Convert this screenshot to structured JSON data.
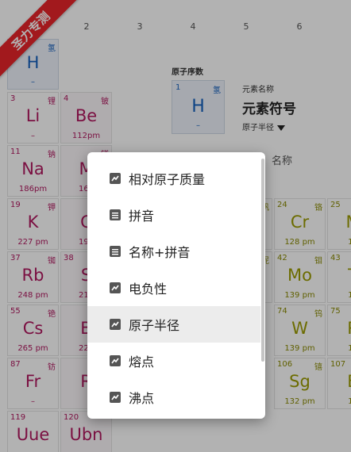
{
  "column_numbers": [
    "2",
    "3",
    "4",
    "5",
    "6"
  ],
  "legend": {
    "title": "原子序数",
    "cell": {
      "number": "1",
      "name": "氢",
      "symbol": "H",
      "radius": "–"
    },
    "name_label": "元素名称",
    "symbol_label": "元素符号",
    "property_label": "原子半径",
    "name_label_2": "名称"
  },
  "cells": [
    {
      "number": "",
      "name": "氢",
      "symbol": "H",
      "radius": "–",
      "color": "blue"
    },
    {
      "number": "3",
      "name": "锂",
      "symbol": "Li",
      "radius": "–",
      "color": "magenta"
    },
    {
      "number": "4",
      "name": "铍",
      "symbol": "Be",
      "radius": "112pm",
      "color": "magenta"
    },
    {
      "number": "11",
      "name": "钠",
      "symbol": "Na",
      "radius": "186pm",
      "color": "magenta"
    },
    {
      "number": "",
      "name": "镁",
      "symbol": "M",
      "radius": "160",
      "color": "magenta"
    },
    {
      "number": "19",
      "name": "钾",
      "symbol": "K",
      "radius": "227 pm",
      "color": "magenta"
    },
    {
      "number": "",
      "name": "",
      "symbol": "C",
      "radius": "197",
      "color": "magenta"
    },
    {
      "number": "37",
      "name": "铷",
      "symbol": "Rb",
      "radius": "248 pm",
      "color": "magenta"
    },
    {
      "number": "38",
      "name": "",
      "symbol": "S",
      "radius": "215",
      "color": "magenta"
    },
    {
      "number": "55",
      "name": "铯",
      "symbol": "Cs",
      "radius": "265 pm",
      "color": "magenta"
    },
    {
      "number": "",
      "name": "",
      "symbol": "B",
      "radius": "222",
      "color": "magenta"
    },
    {
      "number": "87",
      "name": "钫",
      "symbol": "Fr",
      "radius": "–",
      "color": "magenta"
    },
    {
      "number": "",
      "name": "",
      "symbol": "R",
      "radius": "",
      "color": "magenta"
    },
    {
      "number": "119",
      "name": "",
      "symbol": "Uue",
      "radius": "",
      "color": "magenta"
    },
    {
      "number": "120",
      "name": "",
      "symbol": "Ubn",
      "radius": "",
      "color": "magenta"
    },
    {
      "number": "",
      "name": "钒",
      "symbol": "",
      "radius": "",
      "color": "olive"
    },
    {
      "number": "24",
      "name": "铬",
      "symbol": "Cr",
      "radius": "128 pm",
      "color": "olive"
    },
    {
      "number": "25",
      "name": "",
      "symbol": "M",
      "radius": "12",
      "color": "olive"
    },
    {
      "number": "",
      "name": "铌",
      "symbol": "",
      "radius": "",
      "color": "olive"
    },
    {
      "number": "42",
      "name": "钼",
      "symbol": "Mo",
      "radius": "139 pm",
      "color": "olive"
    },
    {
      "number": "43",
      "name": "",
      "symbol": "T",
      "radius": "13",
      "color": "olive"
    },
    {
      "number": "74",
      "name": "钨",
      "symbol": "W",
      "radius": "139 pm",
      "color": "olive"
    },
    {
      "number": "75",
      "name": "",
      "symbol": "R",
      "radius": "13",
      "color": "olive"
    },
    {
      "number": "106",
      "name": "𬭳",
      "symbol": "Sg",
      "radius": "132 pm",
      "color": "olive"
    },
    {
      "number": "107",
      "name": "",
      "symbol": "B",
      "radius": "12",
      "color": "olive"
    }
  ],
  "menu": {
    "items": [
      {
        "label": "相对原子质量",
        "icon": "chart-icon",
        "highlighted": false
      },
      {
        "label": "拼音",
        "icon": "list-icon",
        "highlighted": false
      },
      {
        "label": "名称+拼音",
        "icon": "list-icon",
        "highlighted": false
      },
      {
        "label": "电负性",
        "icon": "chart-icon",
        "highlighted": false
      },
      {
        "label": "原子半径",
        "icon": "chart-icon",
        "highlighted": true
      },
      {
        "label": "熔点",
        "icon": "chart-icon",
        "highlighted": false
      },
      {
        "label": "沸点",
        "icon": "chart-icon",
        "highlighted": false
      }
    ]
  },
  "ribbon": {
    "text": "圣力专测",
    "color": "#e8242a"
  },
  "colors": {
    "magenta": "#b0185f",
    "olive": "#9b9b00",
    "blue": "#1560bd"
  }
}
